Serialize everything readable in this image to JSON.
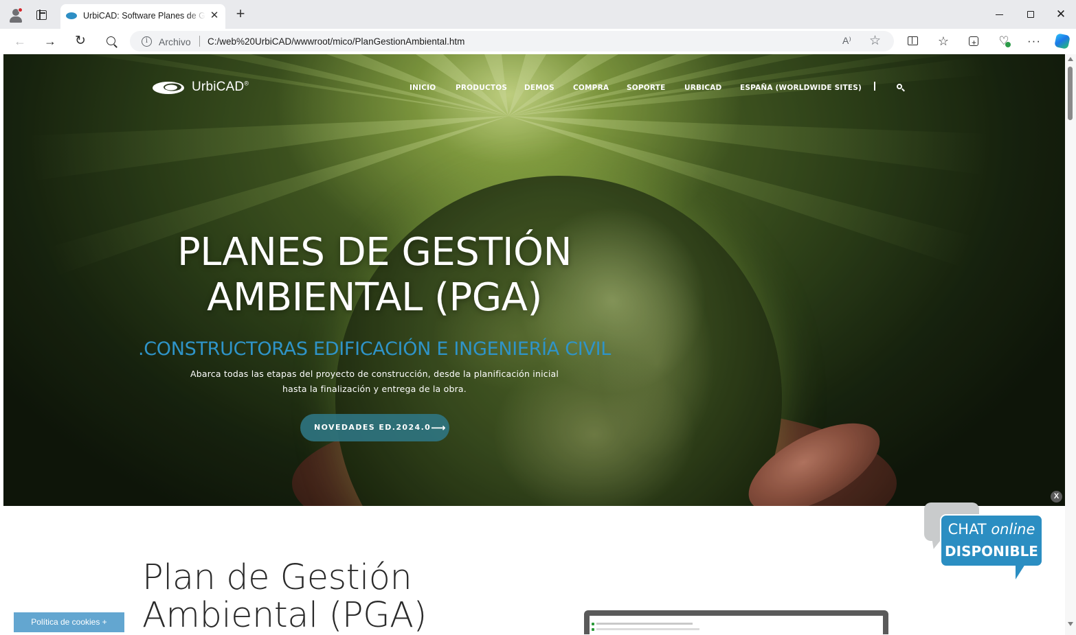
{
  "browser": {
    "tab_title": "UrbiCAD: Software Planes de Gestión Ambiental",
    "tab_close": "✕",
    "new_tab": "+",
    "address": {
      "scheme_label": "Archivo",
      "url": "C:/web%20UrbiCAD/wwwroot/mico/PlanGestionAmbiental.htm",
      "read_aloud": "A⁾"
    },
    "icons": [
      "profile-icon",
      "tab-actions-icon",
      "back-icon",
      "forward-icon",
      "reload-icon",
      "search-icon",
      "info-icon",
      "read-aloud-icon",
      "favorite-star-icon",
      "split-screen-icon",
      "favorites-icon",
      "collections-icon",
      "browser-essentials-icon",
      "more-icon",
      "copilot-icon",
      "minimize-icon",
      "maximize-icon",
      "close-icon"
    ]
  },
  "site": {
    "logo_text": "UrbiCAD",
    "logo_reg": "®",
    "nav": [
      {
        "label": "INICIO"
      },
      {
        "label": "PRODUCTOS"
      },
      {
        "label": "DEMOS"
      },
      {
        "label": "COMPRA"
      },
      {
        "label": "SOPORTE"
      },
      {
        "label": "URBICAD"
      },
      {
        "label": "ESPAÑA (WORLDWIDE SITES)"
      }
    ],
    "hero": {
      "title_line1": "PLANES DE GESTIÓN",
      "title_line2": "AMBIENTAL (PGA)",
      "subtitle": ".CONSTRUCTORAS EDIFICACIÓN E INGENIERÍA CIVIL",
      "desc_line1": "Abarca todas las etapas del proyecto de construcción, desde la planificación inicial",
      "desc_line2": "hasta la finalización y entrega de la obra.",
      "button_label": "NOVEDADES ED.2024.0",
      "button_arrow": "⟶"
    },
    "content": {
      "title_line1": "Plan de Gestión",
      "title_line2": "Ambiental (PGA)"
    },
    "cookies_label": "Política de cookies +",
    "chat": {
      "close": "X",
      "line1_a": "CHAT",
      "line1_b": "online",
      "line2": "DISPONIBLE"
    },
    "colors": {
      "accent_blue": "#2f94c8",
      "button_teal": "#2f7684",
      "cookies_blue": "#63a6d0",
      "chat_blue": "#2b8ec2"
    }
  }
}
